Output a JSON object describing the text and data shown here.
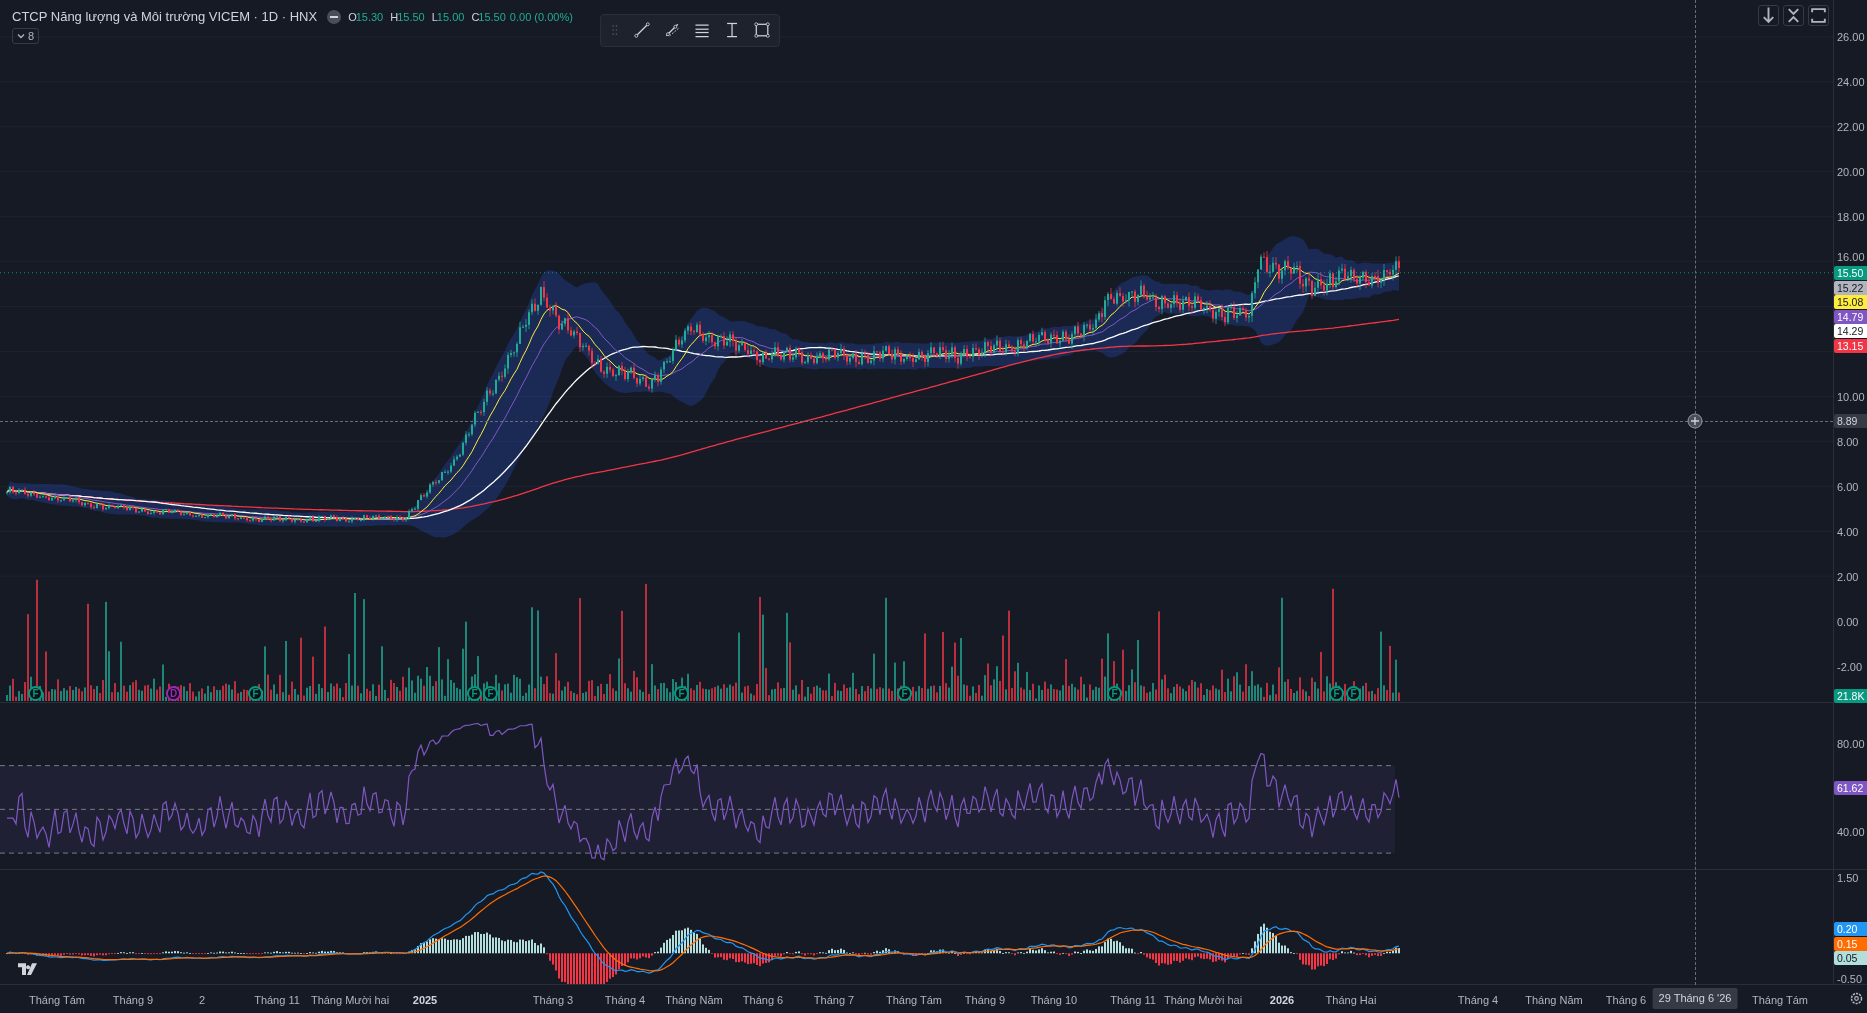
{
  "header": {
    "title": "CTCP Năng lượng và Môi trường VICEM · 1D · HNX",
    "ohlc": [
      {
        "label": "O",
        "value": "15.30"
      },
      {
        "label": "H",
        "value": "15.50"
      },
      {
        "label": "L",
        "value": "15.00"
      },
      {
        "label": "C",
        "value": "15.50"
      }
    ],
    "change": "0.00 (0.00%)",
    "indicators_count": "8"
  },
  "price_axis": {
    "labels": [
      "26.00",
      "24.00",
      "22.00",
      "20.00",
      "18.00",
      "16.00",
      "10.00",
      "8.00",
      "6.00",
      "4.00",
      "2.00",
      "0.00",
      "-2.00"
    ],
    "badges": [
      {
        "text": "15.50",
        "color": "#089981"
      },
      {
        "text": "15.22",
        "color": "#b2b5be"
      },
      {
        "text": "15.08",
        "color": "#ffeb3b"
      },
      {
        "text": "14.79",
        "color": "#7e57c2"
      },
      {
        "text": "14.29",
        "color": "#ffffff"
      },
      {
        "text": "13.15",
        "color": "#f23645"
      }
    ],
    "volume_badge": {
      "text": "21.8K",
      "color": "#089981"
    }
  },
  "crosshair": {
    "price": "8.89",
    "date": "29 Tháng 6 '26"
  },
  "events": [
    {
      "label": "F",
      "color": "#089981"
    },
    {
      "label": "D",
      "color": "#9c27b0"
    },
    {
      "label": "F",
      "color": "#089981"
    },
    {
      "label": "F",
      "color": "#089981"
    },
    {
      "label": "F",
      "color": "#089981"
    },
    {
      "label": "F",
      "color": "#089981"
    },
    {
      "label": "F",
      "color": "#089981"
    },
    {
      "label": "F",
      "color": "#089981"
    },
    {
      "label": "F",
      "color": "#089981"
    },
    {
      "label": "F",
      "color": "#089981"
    }
  ],
  "rsi_axis": {
    "labels": [
      "80.00",
      "40.00"
    ],
    "badge": {
      "text": "61.62",
      "color": "#7e57c2"
    }
  },
  "macd_axis": {
    "labels": [
      "1.50",
      "-0.50"
    ],
    "badges": [
      {
        "text": "0.20",
        "color": "#2196f3"
      },
      {
        "text": "0.15",
        "color": "#ff6d00"
      },
      {
        "text": "0.05",
        "color": "#b2dfdb"
      }
    ]
  },
  "time_axis": [
    {
      "label": "Tháng Tám",
      "kind": "month"
    },
    {
      "label": "Tháng 9",
      "kind": "month"
    },
    {
      "label": "2",
      "kind": "month"
    },
    {
      "label": "Tháng 11",
      "kind": "month"
    },
    {
      "label": "Tháng Mười hai",
      "kind": "month"
    },
    {
      "label": "2025",
      "kind": "year"
    },
    {
      "label": "Tháng 3",
      "kind": "month"
    },
    {
      "label": "Tháng 4",
      "kind": "month"
    },
    {
      "label": "Tháng Năm",
      "kind": "month"
    },
    {
      "label": "Tháng 6",
      "kind": "month"
    },
    {
      "label": "Tháng 7",
      "kind": "month"
    },
    {
      "label": "Tháng Tám",
      "kind": "month"
    },
    {
      "label": "Tháng 9",
      "kind": "month"
    },
    {
      "label": "Tháng 10",
      "kind": "month"
    },
    {
      "label": "Tháng 11",
      "kind": "month"
    },
    {
      "label": "Tháng Mười hai",
      "kind": "month"
    },
    {
      "label": "2026",
      "kind": "year"
    },
    {
      "label": "Tháng Hai",
      "kind": "month"
    },
    {
      "label": "Tháng 4",
      "kind": "month"
    },
    {
      "label": "Tháng Năm",
      "kind": "month"
    },
    {
      "label": "Tháng 6",
      "kind": "month"
    },
    {
      "label": "Tháng Tám",
      "kind": "month"
    }
  ]
}
